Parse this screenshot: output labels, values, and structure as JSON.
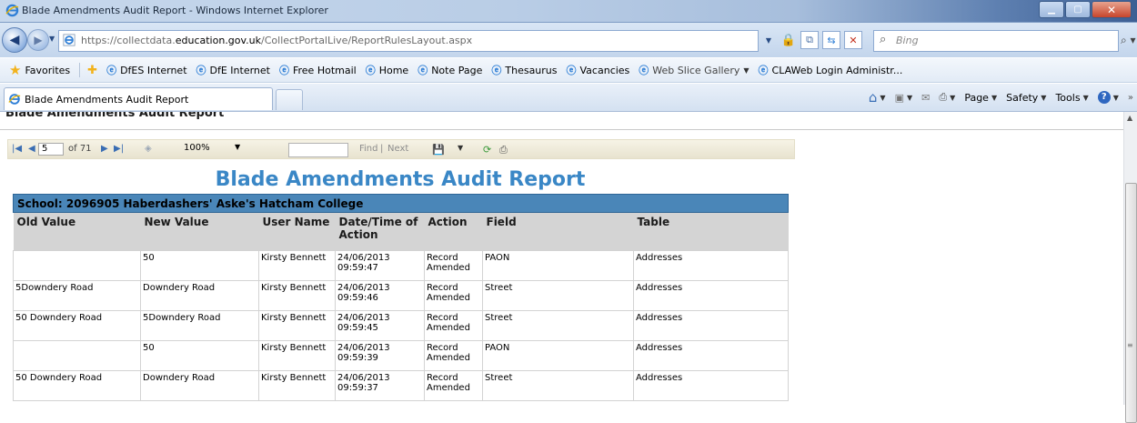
{
  "window": {
    "title": "Blade Amendments Audit Report - Windows Internet Explorer"
  },
  "address": {
    "url_prefix": "https://collectdata.",
    "url_domain": "education.gov.uk",
    "url_path": "/CollectPortalLive/ReportRulesLayout.aspx",
    "search_placeholder": "Bing"
  },
  "favorites": {
    "label": "Favorites",
    "items": [
      "DfES Internet",
      "DfE Internet",
      "Free Hotmail",
      "Home",
      "Note Page",
      "Thesaurus",
      "Vacancies",
      "Web Slice Gallery",
      "CLAWeb Login Administr..."
    ]
  },
  "tab": {
    "label": "Blade Amendments Audit Report"
  },
  "commandbar": {
    "page": "Page",
    "safety": "Safety",
    "tools": "Tools"
  },
  "page": {
    "heading": "Blade Amendments Audit Report"
  },
  "report_toolbar": {
    "page_value": "5",
    "page_of": "of 71",
    "zoom": "100%",
    "find": "Find",
    "sep": "|",
    "next": "Next"
  },
  "report": {
    "title": "Blade Amendments Audit Report",
    "school": "School: 2096905 Haberdashers' Aske's Hatcham College",
    "columns": [
      "Old Value",
      "New Value",
      "User Name",
      "Date/Time of Action",
      "Action",
      "Field",
      "Table"
    ],
    "rows": [
      [
        "",
        "50",
        "Kirsty Bennett",
        "24/06/2013 09:59:47",
        "Record Amended",
        "PAON",
        "Addresses"
      ],
      [
        "5Downdery Road",
        "Downdery Road",
        "Kirsty Bennett",
        "24/06/2013 09:59:46",
        "Record Amended",
        "Street",
        "Addresses"
      ],
      [
        "50 Downdery Road",
        "5Downdery Road",
        "Kirsty Bennett",
        "24/06/2013 09:59:45",
        "Record Amended",
        "Street",
        "Addresses"
      ],
      [
        "",
        "50",
        "Kirsty Bennett",
        "24/06/2013 09:59:39",
        "Record Amended",
        "PAON",
        "Addresses"
      ],
      [
        "50 Downdery Road",
        "Downdery Road",
        "Kirsty Bennett",
        "24/06/2013 09:59:37",
        "Record Amended",
        "Street",
        "Addresses"
      ]
    ]
  },
  "colors": {
    "report_title": "#3a87c6",
    "school_bar": "#4a86b8",
    "header_bg": "#d4d4d4"
  }
}
